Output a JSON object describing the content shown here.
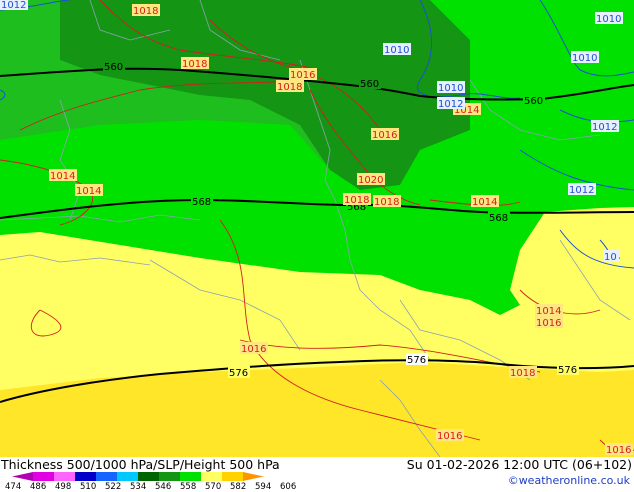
{
  "map": {
    "contours_thickness": {
      "lbl_560_a": "560",
      "lbl_560_b": "560",
      "lbl_560_c": "560",
      "lbl_568_a": "568",
      "lbl_568_b": "568",
      "lbl_568_c": "568",
      "lbl_576_a": "576",
      "lbl_576_b": "576",
      "lbl_576_c": "576"
    },
    "isobars_red": {
      "r1": "1018",
      "r2": "1018",
      "r3": "1016",
      "r4": "1018",
      "r5": "1014",
      "r6": "1016",
      "r7": "1014",
      "r8": "1014",
      "r9": "1020",
      "r10": "1018",
      "r11": "1018",
      "r12": "1014",
      "r13": "1014",
      "r14": "1016",
      "r15": "1016",
      "r16": "1018",
      "r17": "1016",
      "r18": "1016"
    },
    "isobars_blue": {
      "b1": "1012",
      "b2": "1010",
      "b3": "1010",
      "b4": "1010",
      "b5": "1010",
      "b6": "1012",
      "b7": "1012",
      "b8": "1012",
      "b9": "10"
    },
    "colors": {
      "dark_green": "#149614",
      "green": "#1fbe1f",
      "light_green": "#00e100",
      "yellow": "#ffff64",
      "deep_yellow": "#ffe628",
      "black_line": "#000000",
      "red_line": "#d21e1e",
      "blue_line": "#1e50d2"
    }
  },
  "footer": {
    "title": "Thickness 500/1000 hPa/SLP/Height 500 hPa",
    "datetime": "Su 01-02-2026 12:00 UTC (06+102)",
    "credit": "©weatheronline.co.uk"
  },
  "legend": {
    "labels": [
      "474",
      "486",
      "498",
      "510",
      "522",
      "534",
      "546",
      "558",
      "570",
      "582",
      "594",
      "606"
    ],
    "colors": [
      "#b400b4",
      "#e100e1",
      "#ff64ff",
      "#0000c8",
      "#1464ff",
      "#00c8ff",
      "#006400",
      "#149614",
      "#00e100",
      "#ffff64",
      "#ffd200",
      "#ff9600"
    ]
  }
}
